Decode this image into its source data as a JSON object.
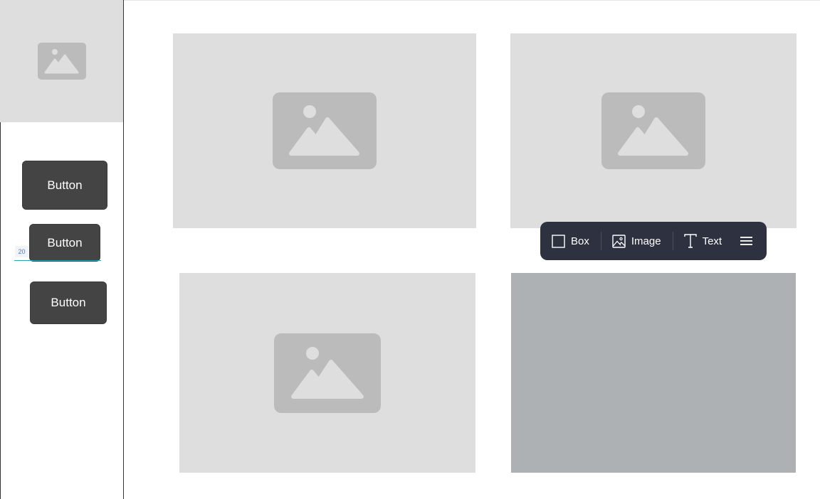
{
  "sidebar": {
    "image_icon": "image-placeholder-icon",
    "buttons": [
      {
        "label": "Button"
      },
      {
        "label": "Button"
      },
      {
        "label": "Button"
      }
    ],
    "spacing_badge": "20"
  },
  "cards": [
    {
      "icon": "image-placeholder-icon"
    },
    {
      "icon": "image-placeholder-icon"
    },
    {
      "icon": "image-placeholder-icon"
    },
    {
      "icon": "none"
    }
  ],
  "toolbar": {
    "items": [
      {
        "label": "Box",
        "icon": "box-icon"
      },
      {
        "label": "Image",
        "icon": "image-icon"
      },
      {
        "label": "Text",
        "icon": "text-icon"
      }
    ],
    "menu_icon": "menu-icon"
  },
  "colors": {
    "placeholder_bg": "#dedede",
    "placeholder_icon": "#bbbbbb",
    "selected_card_bg": "#aeb1b4",
    "button_bg": "#444444",
    "toolbar_bg": "#2e3240",
    "spacing_line": "#2aa6b3"
  }
}
